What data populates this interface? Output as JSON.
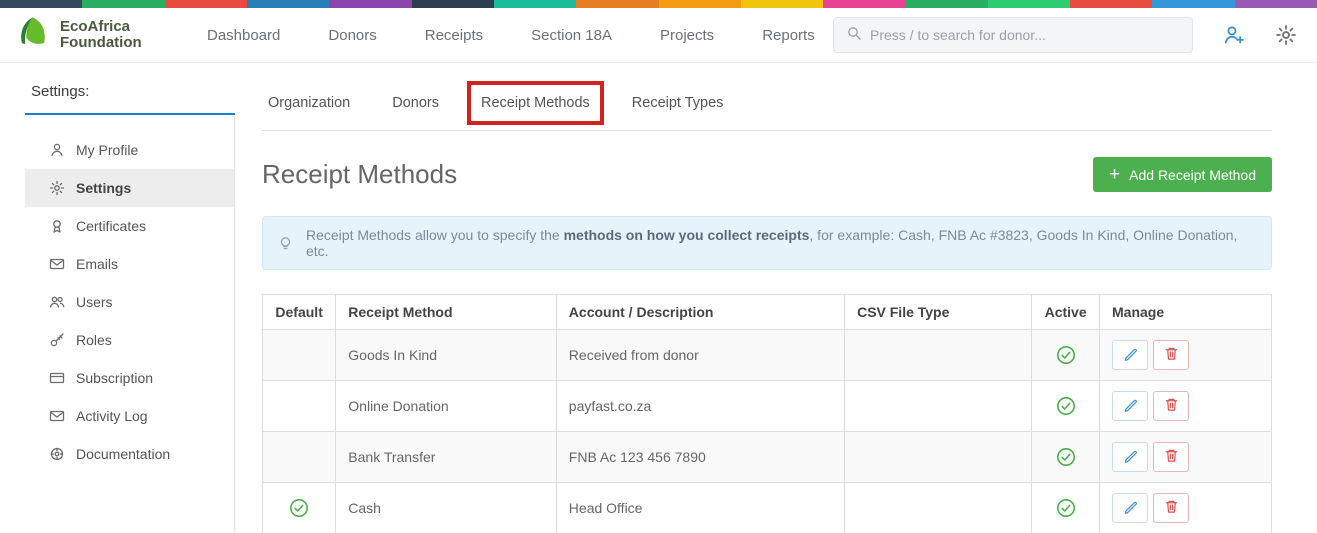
{
  "brand": {
    "line1": "EcoAfrica",
    "line2": "Foundation"
  },
  "nav": {
    "items": [
      "Dashboard",
      "Donors",
      "Receipts",
      "Section 18A",
      "Projects",
      "Reports"
    ]
  },
  "header": {
    "search_placeholder": "Press / to search for donor..."
  },
  "sidebar": {
    "title": "Settings:",
    "items": [
      {
        "label": "My Profile",
        "icon": "user",
        "active": false
      },
      {
        "label": "Settings",
        "icon": "gear",
        "active": true
      },
      {
        "label": "Certificates",
        "icon": "award",
        "active": false
      },
      {
        "label": "Emails",
        "icon": "envelope",
        "active": false
      },
      {
        "label": "Users",
        "icon": "users",
        "active": false
      },
      {
        "label": "Roles",
        "icon": "key",
        "active": false
      },
      {
        "label": "Subscription",
        "icon": "card",
        "active": false
      },
      {
        "label": "Activity Log",
        "icon": "envelope",
        "active": false
      },
      {
        "label": "Documentation",
        "icon": "docgear",
        "active": false
      }
    ]
  },
  "tabs": [
    {
      "label": "Organization",
      "annotated": false
    },
    {
      "label": "Donors",
      "annotated": false
    },
    {
      "label": "Receipt Methods",
      "annotated": true
    },
    {
      "label": "Receipt Types",
      "annotated": false
    }
  ],
  "page": {
    "title": "Receipt Methods",
    "add_button_label": "Add Receipt Method",
    "info": {
      "prefix": "Receipt Methods allow you to specify the ",
      "bold": "methods on how you collect receipts",
      "suffix": ", for example: Cash, FNB Ac #3823, Goods In Kind, Online Donation, etc."
    }
  },
  "table": {
    "headers": [
      "Default",
      "Receipt Method",
      "Account / Description",
      "CSV File Type",
      "Active",
      "Manage"
    ],
    "rows": [
      {
        "default": false,
        "method": "Goods In Kind",
        "account": "Received from donor",
        "csv": "",
        "active": true
      },
      {
        "default": false,
        "method": "Online Donation",
        "account": "payfast.co.za",
        "csv": "",
        "active": true
      },
      {
        "default": false,
        "method": "Bank Transfer",
        "account": "FNB Ac 123 456 7890",
        "csv": "",
        "active": true
      },
      {
        "default": true,
        "method": "Cash",
        "account": "Head Office",
        "csv": "",
        "active": true
      }
    ]
  },
  "colors": {
    "accent_green": "#4cb04f",
    "check_green": "#4cae4c",
    "edit_blue": "#3b8fd4",
    "delete_red": "#d9534f",
    "annotation_red": "#d2231f",
    "banner_bg": "#e7f3fb",
    "sidebar_accent_blue": "#1a7fd4",
    "stripe": [
      "#34495e",
      "#27ae60",
      "#e74c3c",
      "#2980b9",
      "#8e44ad",
      "#2c3e50",
      "#1abc9c",
      "#e67e22",
      "#f39c12",
      "#f1c40f",
      "#e84393",
      "#27ae60",
      "#2ecc71",
      "#e74c3c",
      "#3498db",
      "#9b59b6"
    ]
  }
}
